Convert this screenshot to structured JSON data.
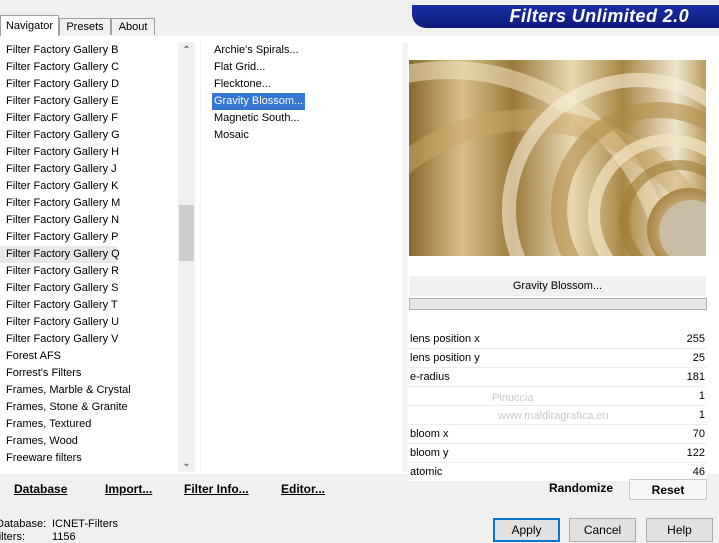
{
  "tabs": [
    {
      "label": "Navigator",
      "active": true
    },
    {
      "label": "Presets",
      "active": false
    },
    {
      "label": "About",
      "active": false
    }
  ],
  "banner": {
    "title": "Filters Unlimited 2.0"
  },
  "categories": [
    "Filter Factory Gallery B",
    "Filter Factory Gallery C",
    "Filter Factory Gallery D",
    "Filter Factory Gallery E",
    "Filter Factory Gallery F",
    "Filter Factory Gallery G",
    "Filter Factory Gallery H",
    "Filter Factory Gallery J",
    "Filter Factory Gallery K",
    "Filter Factory Gallery M",
    "Filter Factory Gallery N",
    "Filter Factory Gallery P",
    "Filter Factory Gallery Q",
    "Filter Factory Gallery R",
    "Filter Factory Gallery S",
    "Filter Factory Gallery T",
    "Filter Factory Gallery U",
    "Filter Factory Gallery V",
    "Forest AFS",
    "Forrest's Filters",
    "Frames, Marble & Crystal",
    "Frames, Stone & Granite",
    "Frames, Textured",
    "Frames, Wood",
    "Freeware filters"
  ],
  "selected_category_index": 12,
  "filters": [
    "Archie's Spirals...",
    "Flat Grid...",
    "Flecktone...",
    "Gravity Blossom...",
    "Magnetic South...",
    "Mosaic"
  ],
  "selected_filter_index": 3,
  "preview": {
    "filter_name": "Gravity Blossom..."
  },
  "parameters": [
    {
      "label": "lens position x",
      "value": "255"
    },
    {
      "label": "lens position y",
      "value": "25"
    },
    {
      "label": "e-radius",
      "value": "181"
    },
    {
      "label": "",
      "value": "1"
    },
    {
      "label": "",
      "value": "1"
    },
    {
      "label": "bloom x",
      "value": "70"
    },
    {
      "label": "bloom y",
      "value": "122"
    },
    {
      "label": "atomic",
      "value": "46"
    }
  ],
  "toolbar": {
    "database": "Database",
    "import": "Import...",
    "filter_info": "Filter Info...",
    "editor": "Editor...",
    "randomize": "Randomize",
    "reset": "Reset"
  },
  "status": {
    "database_label": "Database:",
    "database_value": "ICNET-Filters",
    "filters_label": "Filters:",
    "filters_value": "1156"
  },
  "buttons": {
    "apply": "Apply",
    "cancel": "Cancel",
    "help": "Help"
  },
  "watermark": {
    "line1": "Pinuccia",
    "line2": "www.maldiragrafica.eu"
  },
  "colors": {
    "banner": "#12208f",
    "selection": "#3476d2",
    "default_button_border": "#0078d7"
  }
}
